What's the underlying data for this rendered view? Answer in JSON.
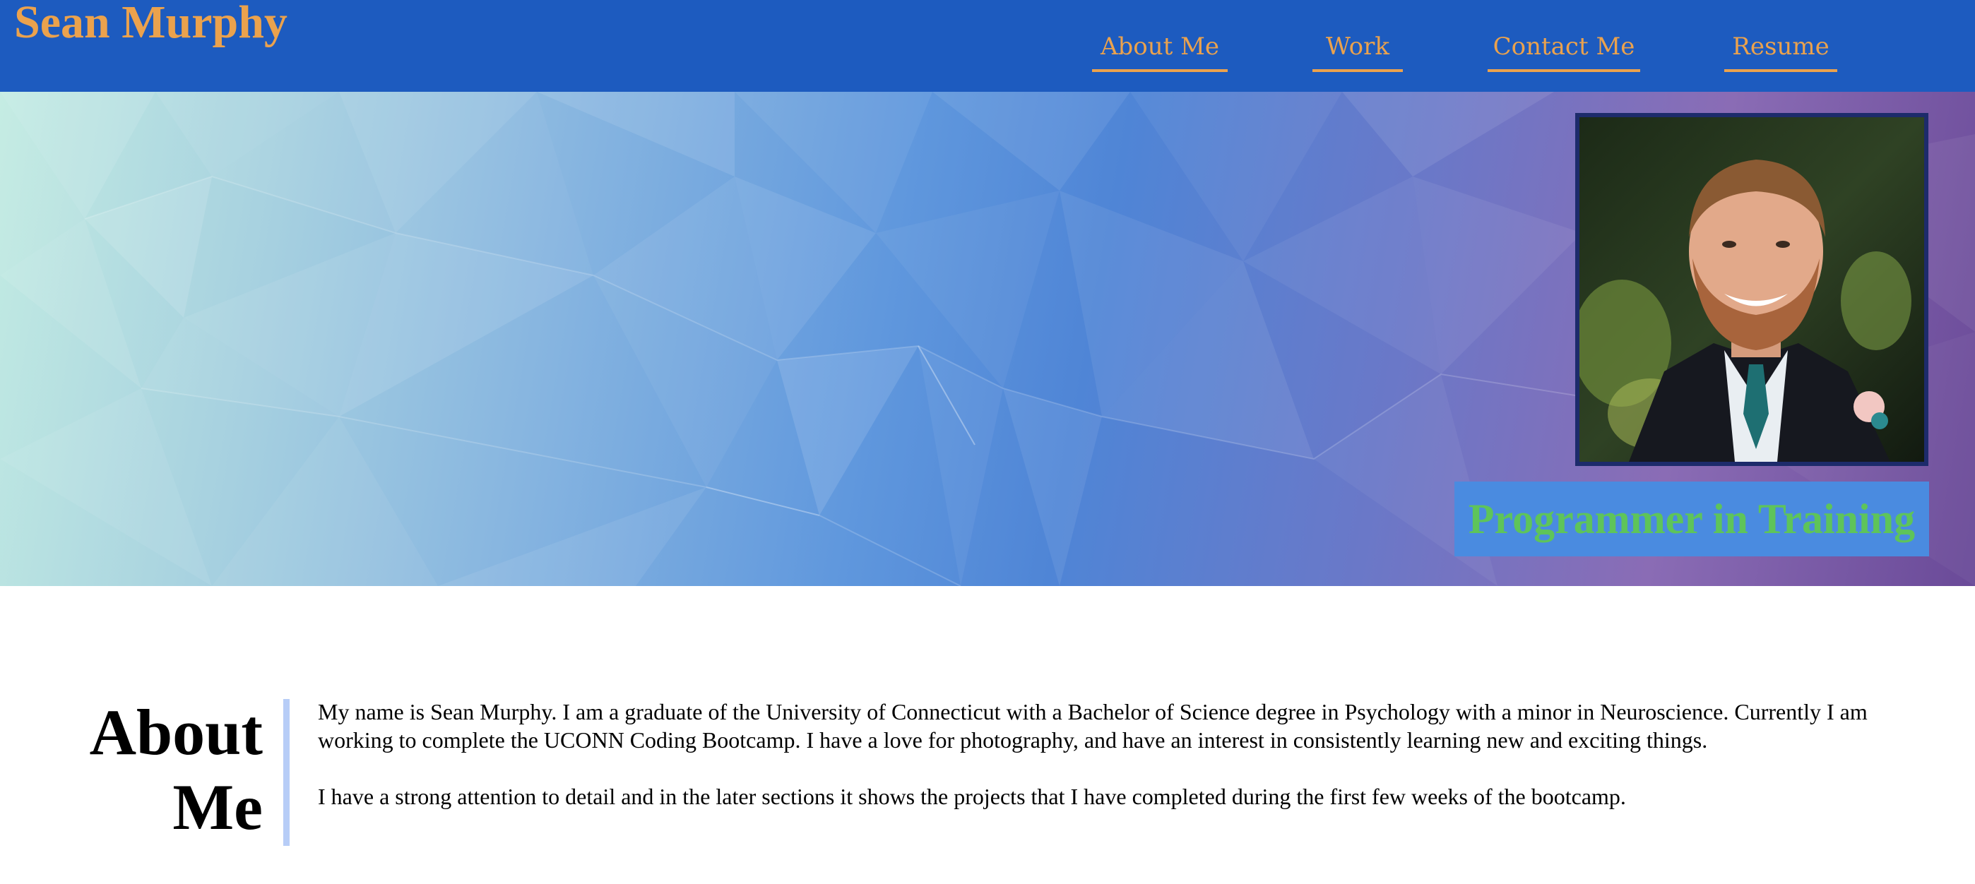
{
  "header": {
    "site_name": "Sean Murphy",
    "nav": [
      {
        "label": "About Me"
      },
      {
        "label": "Work"
      },
      {
        "label": "Contact Me"
      },
      {
        "label": "Resume"
      }
    ]
  },
  "hero": {
    "tagline": "Programmer in Training",
    "portrait_alt": "Sean Murphy portrait"
  },
  "about": {
    "heading_line1": "About",
    "heading_line2": "Me",
    "paragraphs": [
      "My name is Sean Murphy. I am a graduate of the University of Connecticut with a Bachelor of Science degree in Psychology with a minor in Neuroscience. Currently I am working to complete the UCONN Coding Bootcamp. I have a love for photography, and have an interest in consistently learning new and exciting things.",
      "I have a strong attention to detail and in the later sections it shows the projects that I have completed during the first few weeks of the bootcamp."
    ]
  },
  "colors": {
    "header_bg": "#1d5bbf",
    "accent_orange": "#eba24d",
    "tagline_green": "#5ec45a",
    "tagline_bg": "#4a8be0",
    "divider_blue": "#b7cdf7"
  }
}
